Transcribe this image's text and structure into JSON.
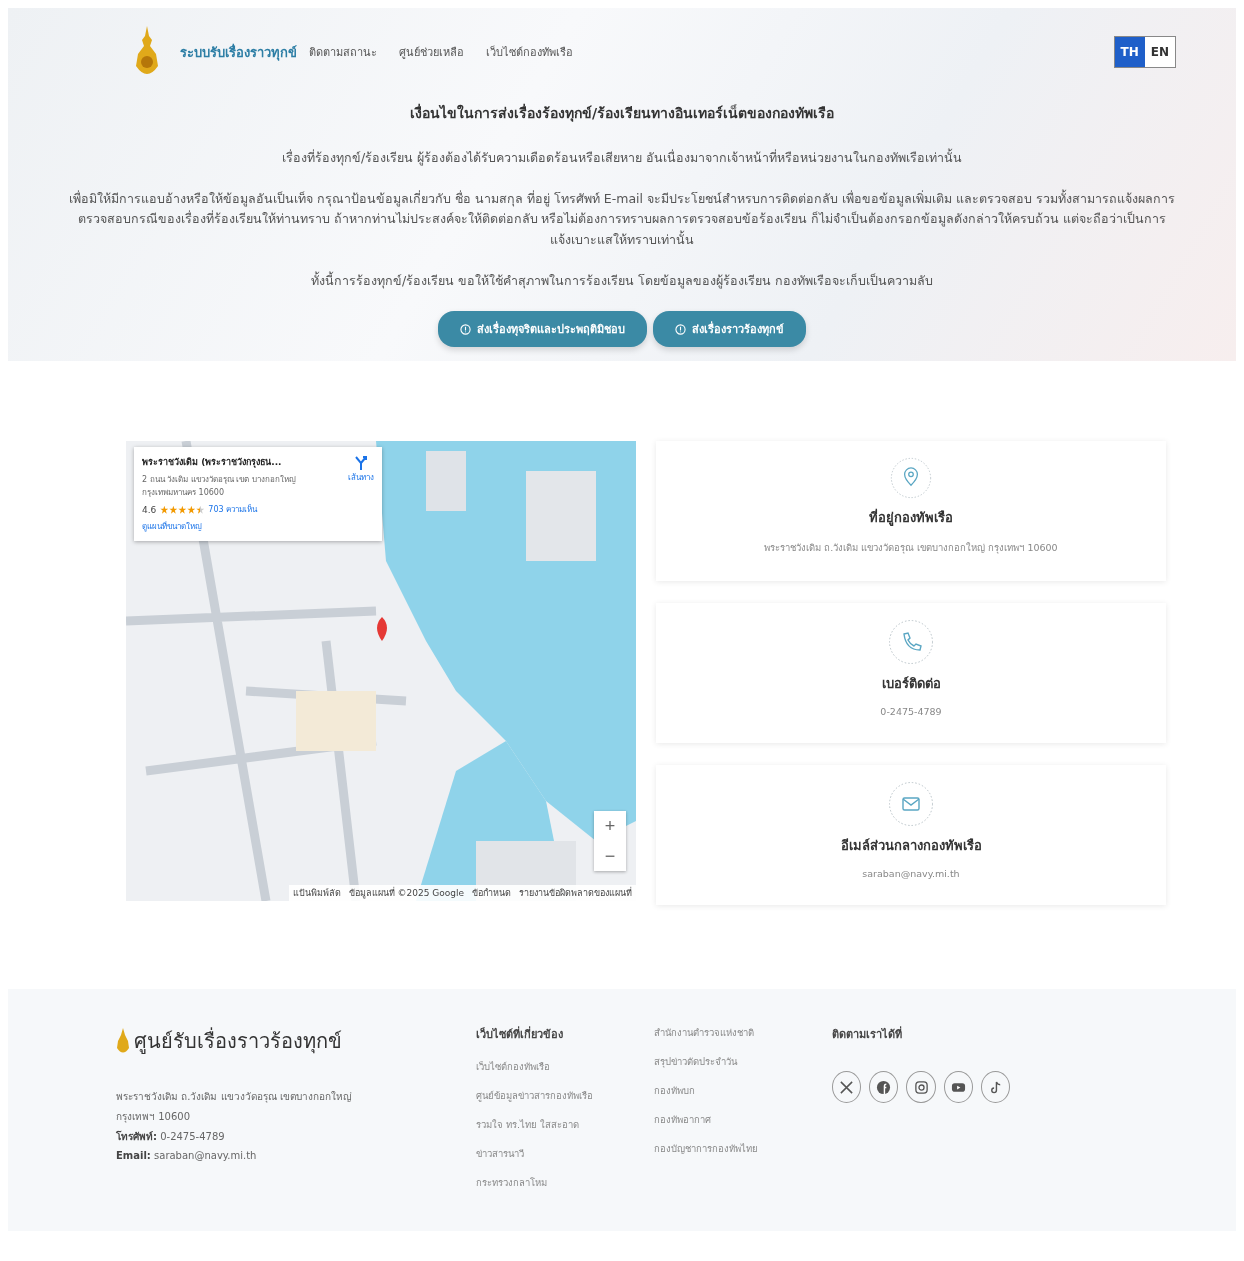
{
  "header": {
    "brand": "ระบบรับเรื่องราวทุกข์",
    "nav": [
      {
        "label": "ติดตามสถานะ"
      },
      {
        "label": "ศูนย์ช่วยเหลือ"
      },
      {
        "label": "เว็บไซต์กองทัพเรือ"
      }
    ],
    "languages": [
      {
        "label": "TH",
        "selected": true
      },
      {
        "label": "EN",
        "selected": false
      }
    ]
  },
  "intro": {
    "title": "เงื่อนไขในการส่งเรื่องร้องทุกข์/ร้องเรียนทางอินเทอร์เน็ตของกองทัพเรือ",
    "paragraphs": [
      "เรื่องที่ร้องทุกข์/ร้องเรียน ผู้ร้องต้องได้รับความเดือดร้อนหรือเสียหาย อันเนื่องมาจากเจ้าหน้าที่หรือหน่วยงานในกองทัพเรือเท่านั้น",
      "เพื่อมิให้มีการแอบอ้างหรือให้ข้อมูลอันเป็นเท็จ กรุณาป้อนข้อมูลเกี่ยวกับ ชื่อ นามสกุล ที่อยู่ โทรศัพท์ E-mail จะมีประโยชน์สำหรบการติดต่อกลับ เพื่อขอข้อมูลเพิ่มเติม และตรวจสอบ รวมทั้งสามารถแจ้งผลการตรวจสอบกรณีของเรื่องที่ร้องเรียนให้ท่านทราบ ถ้าหากท่านไม่ประสงค์จะให้ติดต่อกลับ หรือไม่ต้องการทราบผลการตรวจสอบข้อร้องเรียน ก็ไม่จำเป็นต้องกรอกข้อมูลดังกล่าวให้ครบถ้วน แต่จะถือว่าเป็นการแจ้งเบาะแสให้ทราบเท่านั้น",
      "ทั้งนี้การร้องทุกข์/ร้องเรียน ขอให้ใช้คำสุภาพในการร้องเรียน โดยข้อมูลของผู้ร้องเรียน กองทัพเรือจะเก็บเป็นความลับ"
    ],
    "buttons": [
      {
        "label": "ส่งเรื่องทุจริตและประพฤติมิชอบ"
      },
      {
        "label": "ส่งเรื่องราวร้องทุกข์"
      }
    ]
  },
  "map": {
    "kind": "picture",
    "place_card": {
      "title": "พระราชวังเดิม (พระราชวังกรุงธน...",
      "address": "2 ถนน วังเดิม แขวงวัดอรุณ เขต บางกอกใหญ่ กรุงเทพมหานคร 10600",
      "rating": "4.6",
      "stars": 4.5,
      "reviews": "703 ความเห็น",
      "larger_map": "ดูแผนที่ขนาดใหญ่",
      "directions": "เส้นทาง"
    },
    "zoom_in": "+",
    "zoom_out": "−",
    "attribution": [
      "แป้นพิมพ์ลัด",
      "ข้อมูลแผนที่ ©2025 Google",
      "ข้อกำหนด",
      "รายงานข้อผิดพลาดของแผนที่"
    ]
  },
  "contacts": [
    {
      "kind": "location",
      "title": "ที่อยู่กองทัพเรือ",
      "value": "พระราชวังเดิม ถ.วังเดิม แขวงวัดอรุณ เขตบางกอกใหญ่ กรุงเทพฯ 10600"
    },
    {
      "kind": "phone",
      "title": "เบอร์ติดต่อ",
      "value": "0-2475-4789"
    },
    {
      "kind": "email",
      "title": "อีเมล์ส่วนกลางกองทัพเรือ",
      "value": "saraban@navy.mi.th"
    }
  ],
  "footer": {
    "brand": "ศูนย์รับเรื่องราวร้องทุกข์",
    "address": "พระราชวังเดิม ถ.วังเดิม แขวงวัดอรุณ เขตบางกอกใหญ่ กรุงเทพฯ 10600",
    "phone_label": "โทรศัพท์:",
    "phone": "0-2475-4789",
    "email_label": "Email:",
    "email": "saraban@navy.mi.th",
    "links_title": "เว็บไซต์ที่เกี่ยวข้อง",
    "links_1": [
      "เว็บไซต์กองทัพเรือ",
      "ศูนย์ข้อมูลข่าวสารกองทัพเรือ",
      "รวมใจ ทร.ไทย ใสสะอาด",
      "ข่าวสารนาวี",
      "กระทรวงกลาโหม"
    ],
    "links_2": [
      "สำนักงานตำรวจแห่งชาติ",
      "สรุปข่าวตัดประจำวัน",
      "กองทัพบก",
      "กองทัพอากาศ",
      "กองบัญชาการกองทัพไทย"
    ],
    "social_title": "ติดตามเราได้ที่",
    "social": [
      {
        "kind": "x"
      },
      {
        "kind": "facebook"
      },
      {
        "kind": "instagram"
      },
      {
        "kind": "youtube"
      },
      {
        "kind": "tiktok"
      }
    ]
  }
}
